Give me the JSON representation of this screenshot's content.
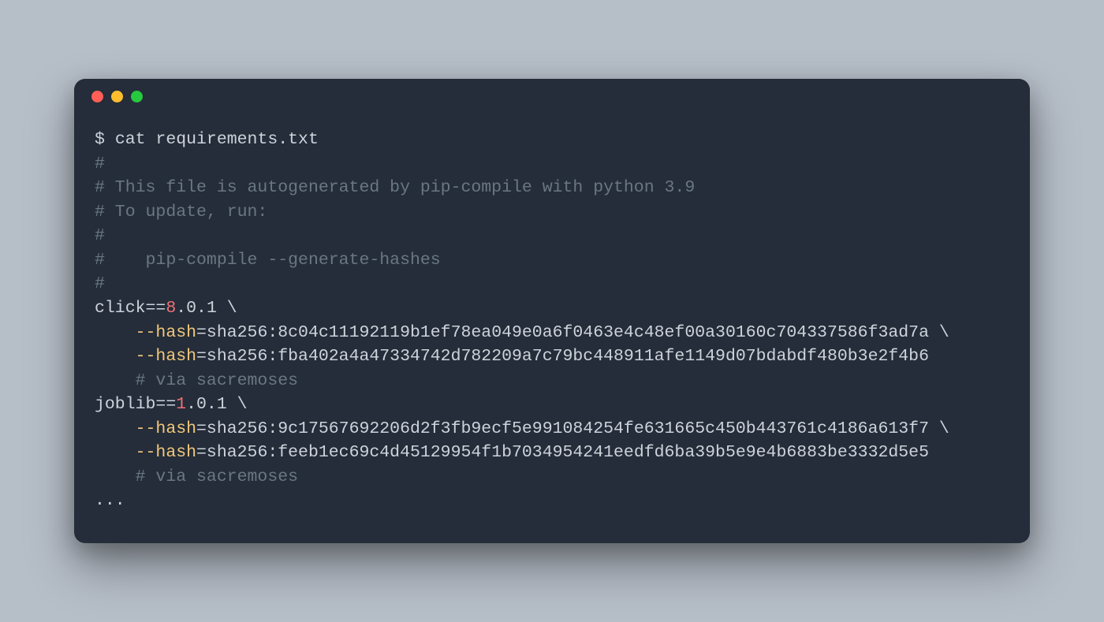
{
  "prompt": "$ ",
  "command": "cat requirements.txt",
  "comments": {
    "c1": "#",
    "c2": "# This file is autogenerated by pip-compile with python 3.9",
    "c3": "# To update, run:",
    "c4": "#",
    "c5": "#    pip-compile --generate-hashes",
    "c6": "#",
    "via": "# via sacremoses"
  },
  "packages": {
    "click": {
      "name": "click==",
      "major": "8",
      "rest": ".0.1 ",
      "backslash": "\\",
      "hash1_prefix": "    ",
      "hash1_dashes": "--",
      "hash1_flag": "hash",
      "hash1_val": "=sha256:8c04c11192119b1ef78ea049e0a6f0463e4c48ef00a30160c704337586f3ad7a ",
      "hash2_prefix": "    ",
      "hash2_dashes": "--",
      "hash2_flag": "hash",
      "hash2_val": "=sha256:fba402a4a47334742d782209a7c79bc448911afe1149d07bdabdf480b3e2f4b6",
      "via_prefix": "    "
    },
    "joblib": {
      "name": "joblib==",
      "major": "1",
      "rest": ".0.1 ",
      "backslash": "\\",
      "hash1_prefix": "    ",
      "hash1_dashes": "--",
      "hash1_flag": "hash",
      "hash1_val": "=sha256:9c17567692206d2f3fb9ecf5e991084254fe631665c450b443761c4186a613f7 ",
      "hash2_prefix": "    ",
      "hash2_dashes": "--",
      "hash2_flag": "hash",
      "hash2_val": "=sha256:feeb1ec69c4d45129954f1b7034954241eedfd6ba39b5e9e4b6883be3332d5e5",
      "via_prefix": "    "
    }
  },
  "ellipsis": "..."
}
